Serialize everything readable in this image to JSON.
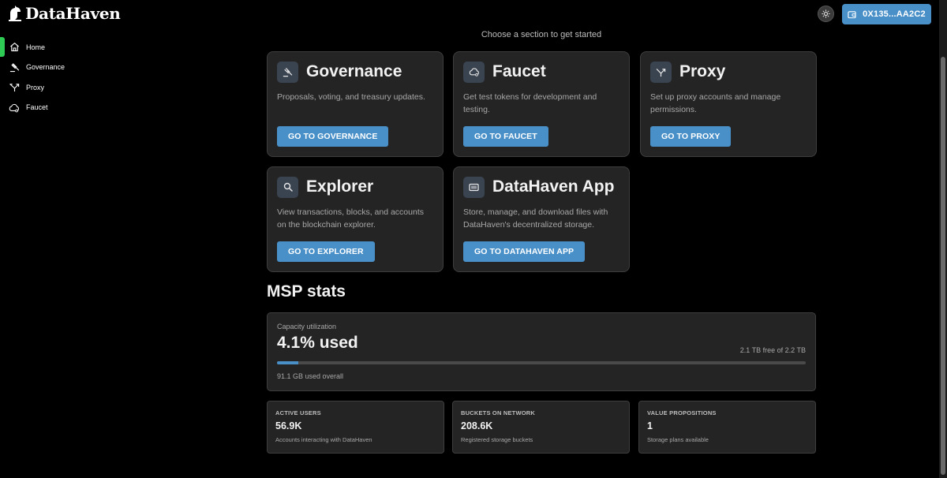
{
  "header": {
    "logo_text": "DataHaven",
    "wallet_label": "0X135...AA2C2"
  },
  "sidebar": {
    "items": [
      {
        "label": "Home",
        "icon": "home-icon",
        "active": true
      },
      {
        "label": "Governance",
        "icon": "gavel-icon"
      },
      {
        "label": "Proxy",
        "icon": "split-arrow-icon"
      },
      {
        "label": "Faucet",
        "icon": "cloud-icon"
      }
    ]
  },
  "main": {
    "subtitle": "Choose a section to get started",
    "cards": [
      {
        "title": "Governance",
        "description": "Proposals, voting, and treasury updates.",
        "button": "GO TO GOVERNANCE",
        "icon": "gavel-icon"
      },
      {
        "title": "Faucet",
        "description": "Get test tokens for development and testing.",
        "button": "GO TO FAUCET",
        "icon": "cloud-icon"
      },
      {
        "title": "Proxy",
        "description": "Set up proxy accounts and manage permissions.",
        "button": "GO TO PROXY",
        "icon": "split-arrow-icon"
      },
      {
        "title": "Explorer",
        "description": "View transactions, blocks, and accounts on the blockchain explorer.",
        "button": "GO TO EXPLORER",
        "icon": "search-icon"
      },
      {
        "title": "DataHaven App",
        "description": "Store, manage, and download files with DataHaven's decentralized storage.",
        "button": "GO TO DATAHAVEN APP",
        "icon": "app-window-icon"
      }
    ]
  },
  "msp": {
    "title": "MSP stats",
    "capacity": {
      "label": "Capacity utilization",
      "value": "4.1% used",
      "percent": 4.1,
      "free_text": "2.1 TB free of 2.2 TB",
      "used_text": "91.1 GB used overall"
    },
    "stats": [
      {
        "label": "ACTIVE USERS",
        "value": "56.9K",
        "desc": "Accounts interacting with DataHaven"
      },
      {
        "label": "BUCKETS ON NETWORK",
        "value": "208.6K",
        "desc": "Registered storage buckets"
      },
      {
        "label": "VALUE PROPOSITIONS",
        "value": "1",
        "desc": "Storage plans available"
      }
    ]
  },
  "colors": {
    "accent": "#4a90c8",
    "active": "#2ecc55",
    "card_bg": "#242424"
  }
}
